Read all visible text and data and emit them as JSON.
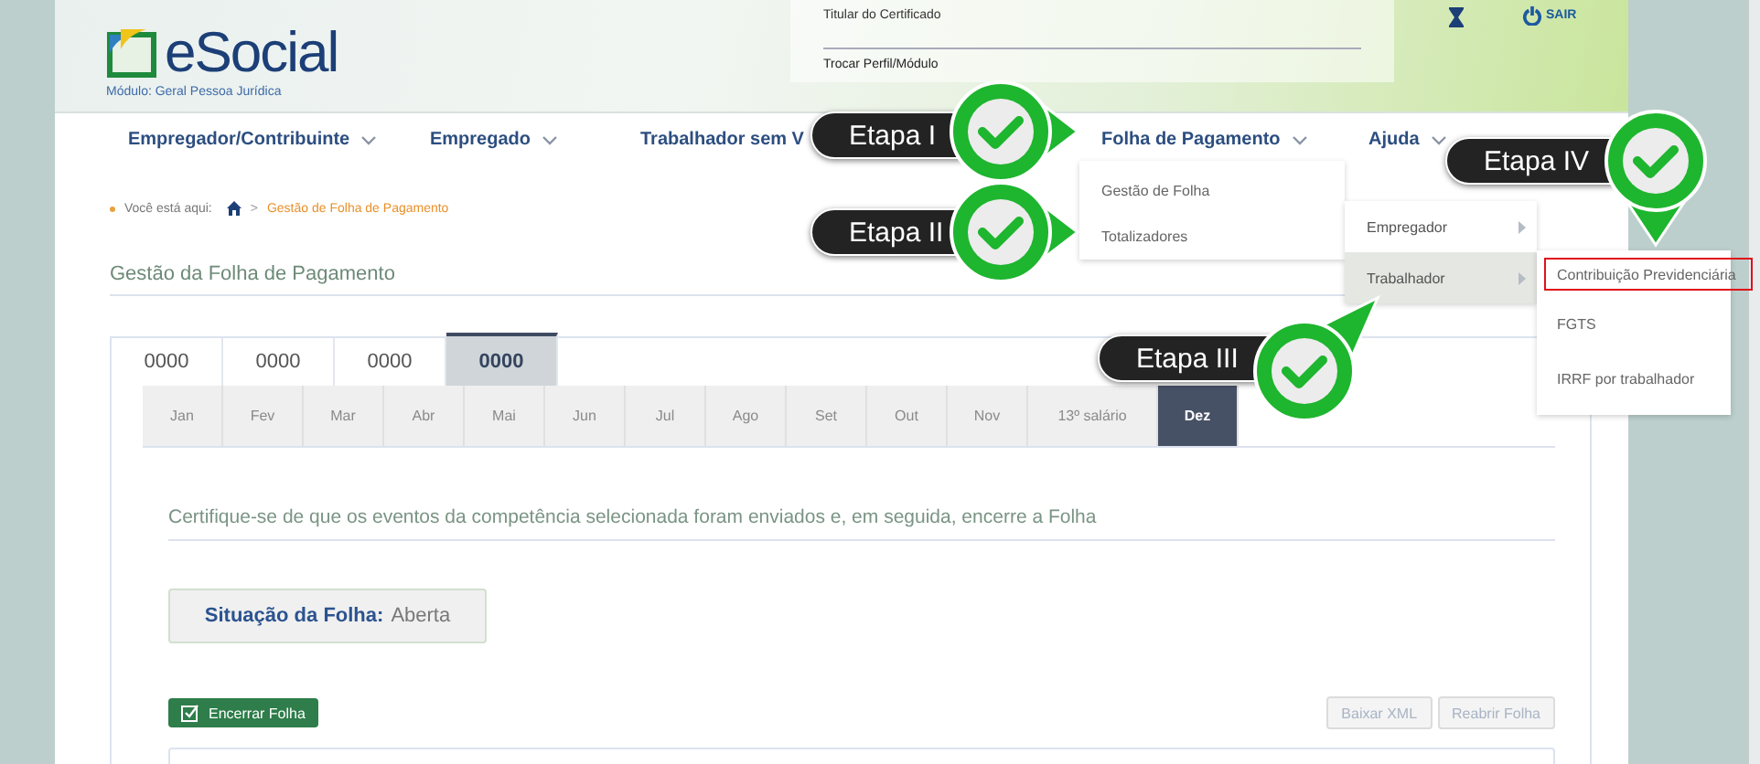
{
  "header": {
    "logo": "eSocial",
    "module": "Módulo: Geral Pessoa Jurídica",
    "certificate_label": "Titular do Certificado",
    "switch_profile": "Trocar Perfil/Módulo",
    "logout": "SAIR"
  },
  "nav": [
    {
      "label": "Empregador/Contribuinte",
      "caret": true
    },
    {
      "label": "Empregado",
      "caret": true
    },
    {
      "label": "Trabalhador sem V",
      "caret": false
    },
    {
      "label": "Folha de Pagamento",
      "caret": true
    },
    {
      "label": "Ajuda",
      "caret": true
    }
  ],
  "folha_menu": [
    "Gestão de Folha",
    "Totalizadores"
  ],
  "ajuda_menu": [
    {
      "label": "Empregador",
      "selected": false
    },
    {
      "label": "Trabalhador",
      "selected": true
    }
  ],
  "trabalhador_menu": [
    {
      "label": "Contribuição Previdenciária",
      "outlined": true
    },
    {
      "label": "FGTS",
      "outlined": false
    },
    {
      "label": "IRRF por trabalhador",
      "outlined": false
    }
  ],
  "breadcrumb": {
    "label": "Você está aqui:",
    "separator": ">",
    "current": "Gestão de Folha de Pagamento"
  },
  "page_title": "Gestão da Folha de Pagamento",
  "years": [
    {
      "label": "0000",
      "selected": false
    },
    {
      "label": "0000",
      "selected": false
    },
    {
      "label": "0000",
      "selected": false
    },
    {
      "label": "0000",
      "selected": true
    }
  ],
  "months": [
    {
      "label": "Jan",
      "selected": false
    },
    {
      "label": "Fev",
      "selected": false
    },
    {
      "label": "Mar",
      "selected": false
    },
    {
      "label": "Abr",
      "selected": false
    },
    {
      "label": "Mai",
      "selected": false
    },
    {
      "label": "Jun",
      "selected": false
    },
    {
      "label": "Jul",
      "selected": false
    },
    {
      "label": "Ago",
      "selected": false
    },
    {
      "label": "Set",
      "selected": false
    },
    {
      "label": "Out",
      "selected": false
    },
    {
      "label": "Nov",
      "selected": false
    },
    {
      "label": "13º salário",
      "selected": false
    },
    {
      "label": "Dez",
      "selected": true
    }
  ],
  "instruction": "Certifique-se de que os eventos da competência selecionada foram enviados e, em seguida, encerre a Folha",
  "status": {
    "label": "Situação da Folha:",
    "value": "Aberta"
  },
  "close_button": "Encerrar Folha",
  "actions": [
    {
      "label": "Baixar XML",
      "disabled": true
    },
    {
      "label": "Reabrir Folha",
      "disabled": true
    }
  ],
  "callouts": [
    {
      "label": "Etapa I",
      "kind": "right"
    },
    {
      "label": "Etapa II",
      "kind": "right"
    },
    {
      "label": "Etapa III",
      "kind": "diagonal"
    },
    {
      "label": "Etapa IV",
      "kind": "down"
    }
  ]
}
